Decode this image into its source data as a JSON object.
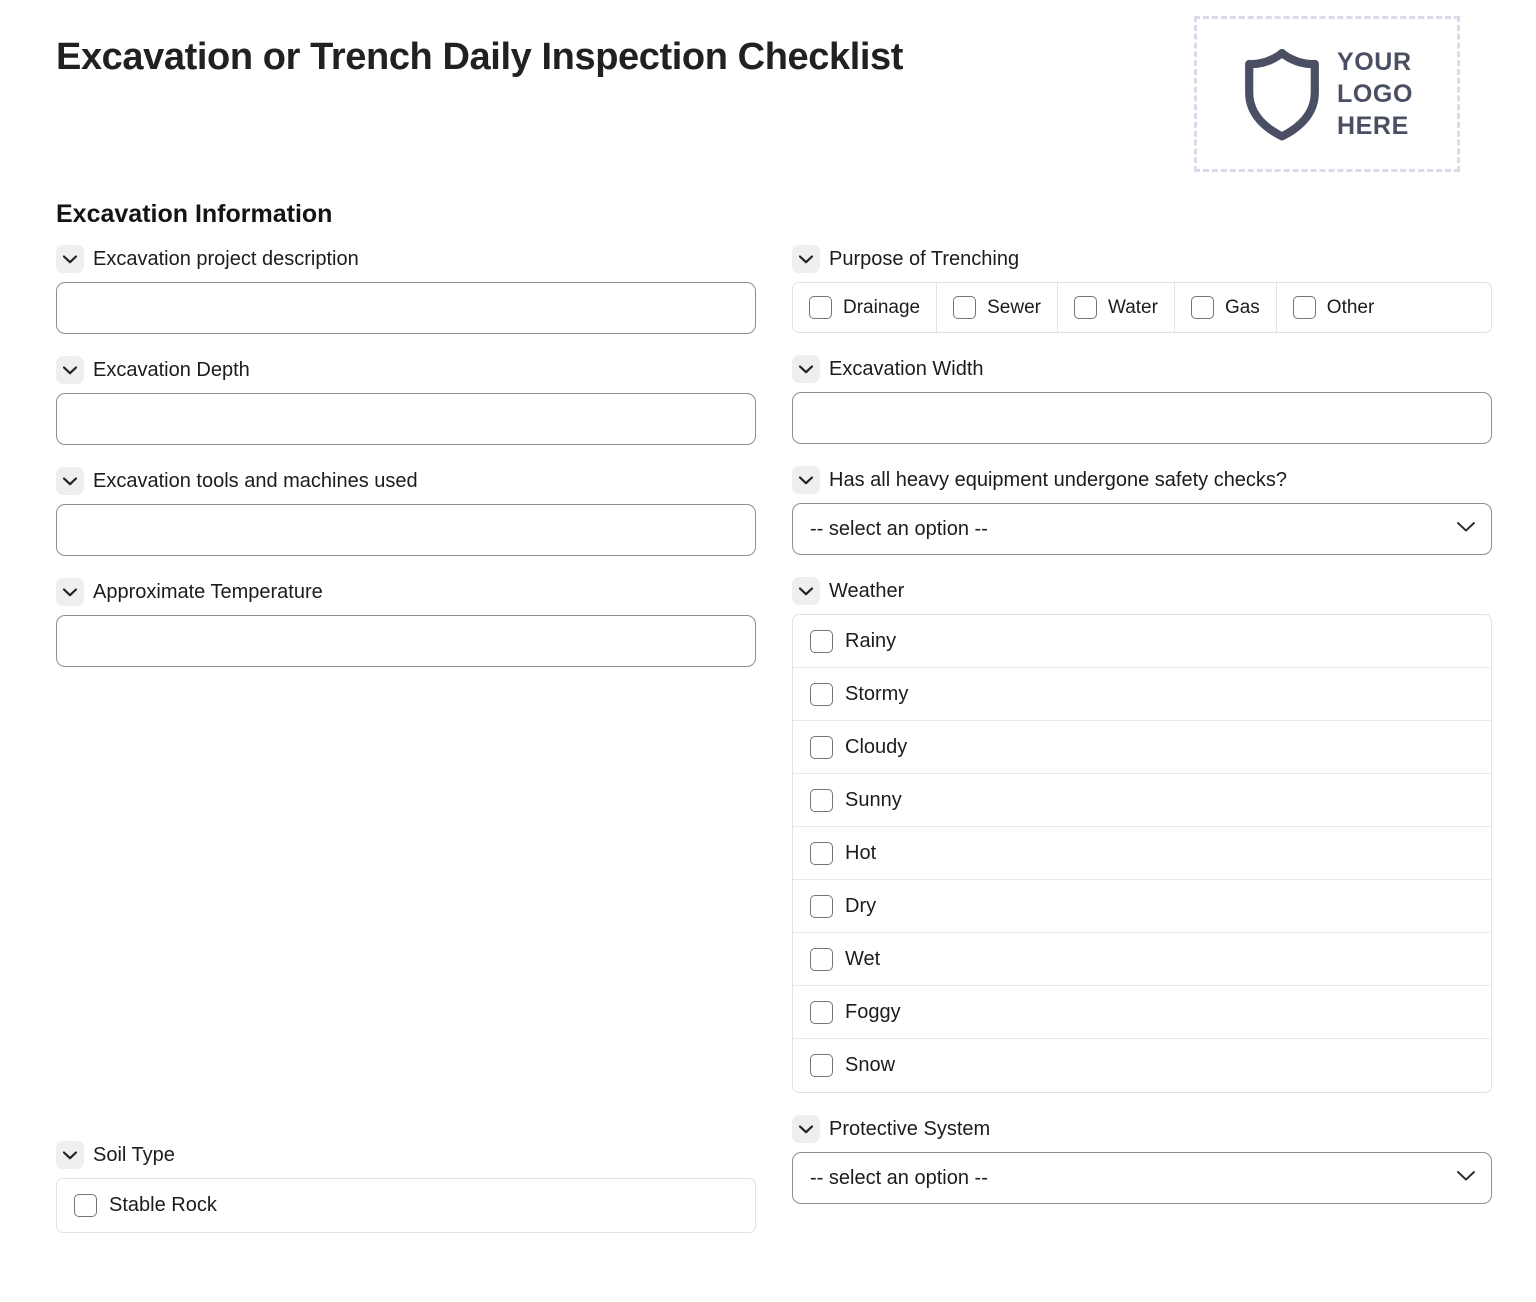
{
  "document": {
    "title": "Excavation or Trench Daily Inspection Checklist"
  },
  "logo": {
    "icon": "shield-icon",
    "line1": "YOUR",
    "line2": "LOGO",
    "line3": "HERE"
  },
  "section": {
    "heading": "Excavation Information"
  },
  "common": {
    "select_placeholder": "-- select an option --",
    "chevron_icon": "chevron-down-icon",
    "checkbox_icon": "checkbox-unchecked-icon"
  },
  "fields": {
    "project_description": {
      "label": "Excavation project description",
      "value": ""
    },
    "purpose_of_trenching": {
      "label": "Purpose of Trenching",
      "options": [
        "Drainage",
        "Sewer",
        "Water",
        "Gas",
        "Other"
      ]
    },
    "excavation_depth": {
      "label": "Excavation Depth",
      "value": ""
    },
    "excavation_width": {
      "label": "Excavation Width",
      "value": ""
    },
    "tools_and_machines": {
      "label": "Excavation tools and machines used",
      "value": ""
    },
    "heavy_equipment_safety": {
      "label": "Has all heavy equipment undergone safety checks?",
      "selected": "-- select an option --"
    },
    "approximate_temperature": {
      "label": "Approximate Temperature",
      "value": ""
    },
    "weather": {
      "label": "Weather",
      "options": [
        "Rainy",
        "Stormy",
        "Cloudy",
        "Sunny",
        "Hot",
        "Dry",
        "Wet",
        "Foggy",
        "Snow"
      ]
    },
    "soil_type": {
      "label": "Soil Type",
      "options": [
        "Stable Rock"
      ]
    },
    "protective_system": {
      "label": "Protective System",
      "selected": "-- select an option --"
    }
  },
  "colors": {
    "logo_shield": "#4b4f63",
    "logo_border": "#d8dce8",
    "input_border": "#8e8e8e",
    "list_border": "#e2e2e2",
    "chevron_bg": "#efeff0"
  }
}
